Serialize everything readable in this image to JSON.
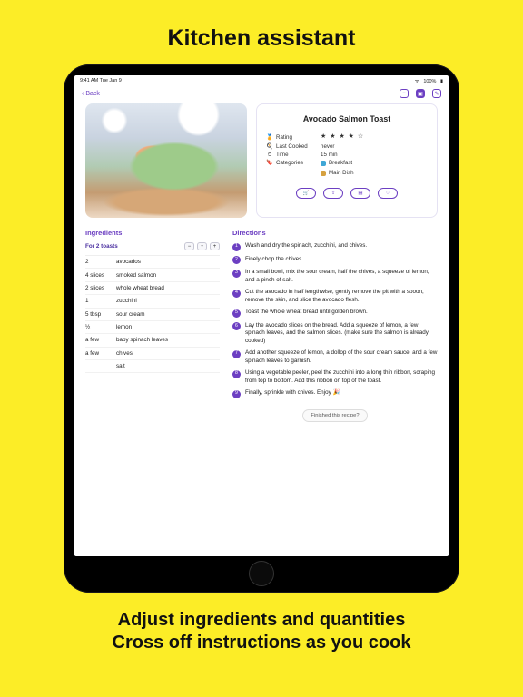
{
  "promo": {
    "headline": "Kitchen assistant",
    "tagline1": "Adjust ingredients and quantities",
    "tagline2": "Cross off instructions as you cook"
  },
  "statusBar": {
    "left": "9:41 AM  Tue Jan 9",
    "right": "100%"
  },
  "nav": {
    "back": "Back"
  },
  "recipe": {
    "title": "Avocado Salmon Toast",
    "meta": {
      "ratingLabel": "Rating",
      "ratingStars": "★ ★ ★ ★ ☆",
      "lastCookedLabel": "Last Cooked",
      "lastCookedValue": "never",
      "timeLabel": "Time",
      "timeValue": "15 min",
      "categoriesLabel": "Categories",
      "cat1": "Breakfast",
      "cat2": "Main Dish"
    }
  },
  "ingredients": {
    "heading": "Ingredients",
    "servings": "For 2 toasts",
    "rows": [
      {
        "q": "2",
        "n": "avocados"
      },
      {
        "q": "4 slices",
        "n": "smoked salmon"
      },
      {
        "q": "2 slices",
        "n": "whole wheat bread"
      },
      {
        "q": "1",
        "n": "zucchini"
      },
      {
        "q": "5 tbsp",
        "n": "sour cream"
      },
      {
        "q": "½",
        "n": "lemon"
      },
      {
        "q": "a few",
        "n": "baby spinach leaves"
      },
      {
        "q": "a few",
        "n": "chives"
      },
      {
        "q": "",
        "n": "salt"
      }
    ]
  },
  "directions": {
    "heading": "Directions",
    "steps": [
      "Wash and dry the spinach, zucchini, and chives.",
      "Finely chop the chives.",
      "In a small bowl, mix the sour cream, half the chives, a squeeze of lemon, and a pinch of salt.",
      "Cut the avocado in half lengthwise, gently remove the pit with a spoon, remove the skin, and slice the avocado flesh.",
      "Toast the whole wheat bread until golden brown.",
      "Lay the avocado slices on the bread. Add a squeeze of lemon, a few spinach leaves, and the salmon slices. (make sure the salmon is already cooked)",
      "Add another squeeze of lemon, a dollop of the sour cream sauce, and a few spinach leaves to garnish.",
      "Using a vegetable peeler, peel the zucchini into a long thin ribbon, scraping from top to bottom. Add this ribbon on top of the toast.",
      "Finally, sprinkle with chives. Enjoy 🎉"
    ],
    "finished": "Finished this recipe?"
  }
}
